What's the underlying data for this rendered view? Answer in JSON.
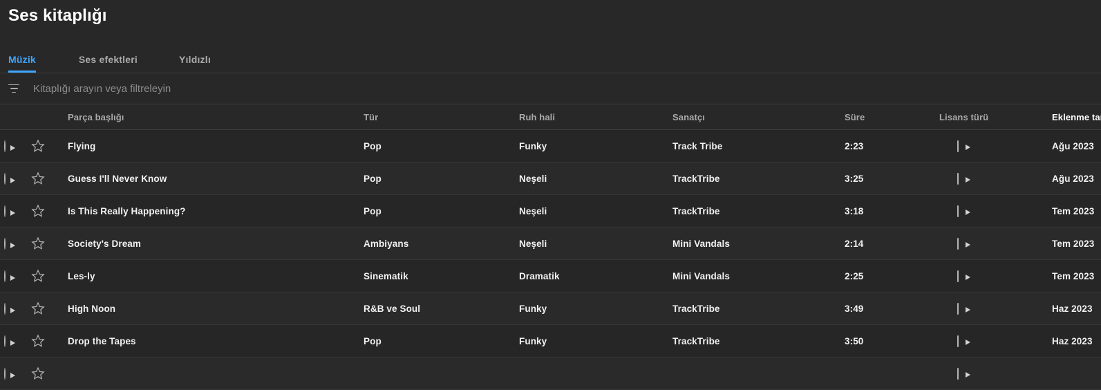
{
  "page_title": "Ses kitaplığı",
  "accent_color": "#3ea6ff",
  "tabs": [
    {
      "label": "Müzik",
      "active": true
    },
    {
      "label": "Ses efektleri",
      "active": false
    },
    {
      "label": "Yıldızlı",
      "active": false
    }
  ],
  "search": {
    "placeholder": "Kitaplığı arayın veya filtreleyin",
    "value": "",
    "filter_icon": "filter-list-icon"
  },
  "table": {
    "columns": [
      {
        "key": "play",
        "label": ""
      },
      {
        "key": "star",
        "label": ""
      },
      {
        "key": "title",
        "label": "Parça başlığı"
      },
      {
        "key": "genre",
        "label": "Tür"
      },
      {
        "key": "mood",
        "label": "Ruh hali"
      },
      {
        "key": "artist",
        "label": "Sanatçı"
      },
      {
        "key": "dur",
        "label": "Süre"
      },
      {
        "key": "lic",
        "label": "Lisans türü"
      },
      {
        "key": "added",
        "label": "Eklenme tarihi"
      }
    ],
    "sorted_column": "Eklenme tarihi",
    "sort_direction": "descending",
    "rows": [
      {
        "title": "Flying",
        "genre": "Pop",
        "mood": "Funky",
        "artist": "Track Tribe",
        "duration": "2:23",
        "license": "youtube-icon",
        "added": "Ağu 2023"
      },
      {
        "title": "Guess I'll Never Know",
        "genre": "Pop",
        "mood": "Neşeli",
        "artist": "TrackTribe",
        "duration": "3:25",
        "license": "youtube-icon",
        "added": "Ağu 2023"
      },
      {
        "title": "Is This Really Happening?",
        "genre": "Pop",
        "mood": "Neşeli",
        "artist": "TrackTribe",
        "duration": "3:18",
        "license": "youtube-icon",
        "added": "Tem 2023"
      },
      {
        "title": "Society's Dream",
        "genre": "Ambiyans",
        "mood": "Neşeli",
        "artist": "Mini Vandals",
        "duration": "2:14",
        "license": "youtube-icon",
        "added": "Tem 2023"
      },
      {
        "title": "Les-ly",
        "genre": "Sinematik",
        "mood": "Dramatik",
        "artist": "Mini Vandals",
        "duration": "2:25",
        "license": "youtube-icon",
        "added": "Tem 2023"
      },
      {
        "title": "High Noon",
        "genre": "R&B ve Soul",
        "mood": "Funky",
        "artist": "TrackTribe",
        "duration": "3:49",
        "license": "youtube-icon",
        "added": "Haz 2023"
      },
      {
        "title": "Drop the Tapes",
        "genre": "Pop",
        "mood": "Funky",
        "artist": "TrackTribe",
        "duration": "3:50",
        "license": "youtube-icon",
        "added": "Haz 2023"
      },
      {
        "title": "",
        "genre": "",
        "mood": "",
        "artist": "",
        "duration": "",
        "license": "youtube-icon",
        "added": ""
      }
    ]
  }
}
